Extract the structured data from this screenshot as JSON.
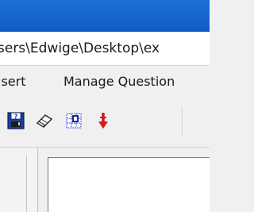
{
  "window": {
    "path": "sers\\Edwige\\Desktop\\ex"
  },
  "menu": {
    "items": [
      {
        "label": "isert"
      },
      {
        "label": "Manage Question"
      }
    ]
  },
  "toolbar": {
    "buttons": [
      {
        "icon": "save-icon"
      },
      {
        "icon": "eraser-icon"
      },
      {
        "icon": "grid-icon"
      },
      {
        "icon": "arrow-down-icon"
      }
    ]
  },
  "colors": {
    "titlebar": "#1b6fd6",
    "save_blue": "#1c3f9c",
    "arrow_red": "#d41818",
    "grid_blue": "#3c50d8"
  }
}
